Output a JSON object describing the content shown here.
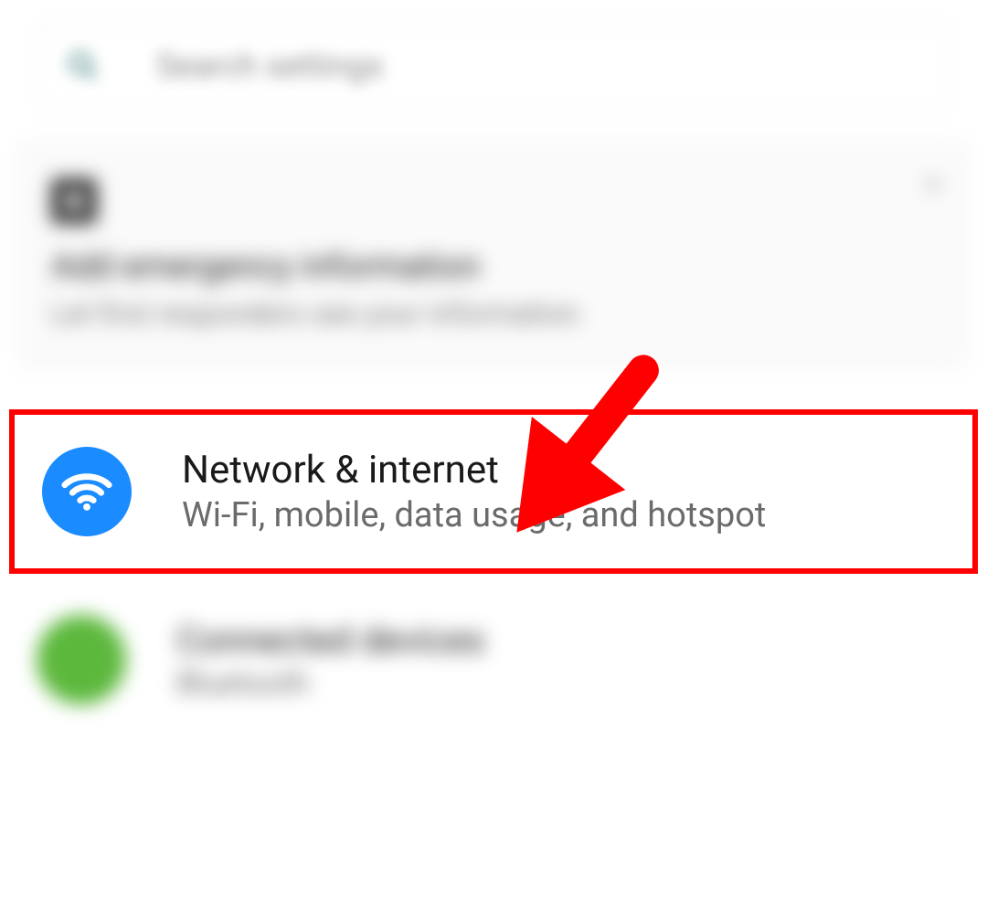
{
  "search": {
    "placeholder": "Search settings",
    "icon_name": "search-icon"
  },
  "emergency": {
    "title": "Add emergency information",
    "subtitle": "Let first responders see your information",
    "icon_name": "plus-icon",
    "close_label": "×"
  },
  "network": {
    "title": "Network & internet",
    "subtitle": "Wi-Fi, mobile, data usage, and hotspot",
    "icon_name": "wifi-icon",
    "icon_color": "#1a8cff"
  },
  "connected": {
    "title": "Connected devices",
    "subtitle": "Bluetooth",
    "icon_name": "devices-icon",
    "icon_color": "#5cb83c"
  },
  "annotation": {
    "type": "arrow",
    "color": "#ff0000"
  }
}
